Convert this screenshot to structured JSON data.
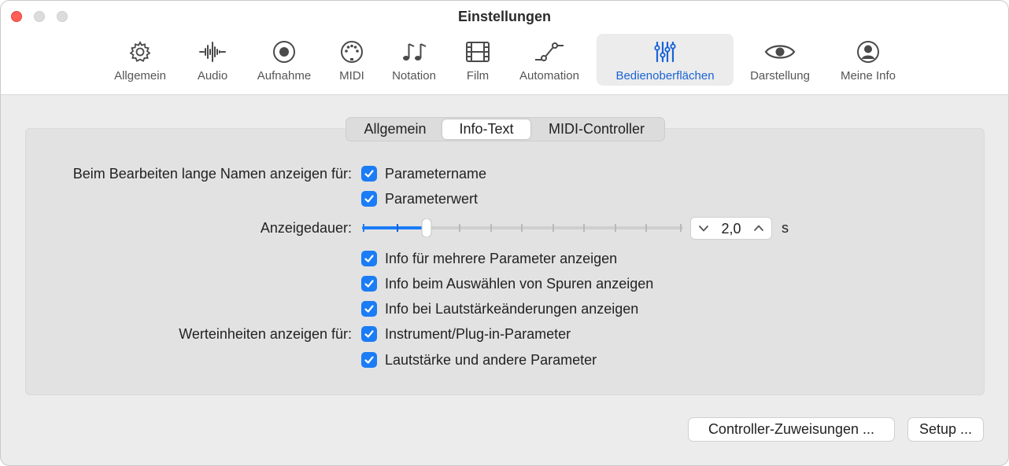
{
  "window": {
    "title": "Einstellungen"
  },
  "toolbar": {
    "items": [
      {
        "label": "Allgemein",
        "icon": "gear-icon"
      },
      {
        "label": "Audio",
        "icon": "waveform-icon"
      },
      {
        "label": "Aufnahme",
        "icon": "record-icon"
      },
      {
        "label": "MIDI",
        "icon": "midi-port-icon"
      },
      {
        "label": "Notation",
        "icon": "music-notes-icon"
      },
      {
        "label": "Film",
        "icon": "film-icon"
      },
      {
        "label": "Automation",
        "icon": "automation-curve-icon"
      },
      {
        "label": "Bedienoberflächen",
        "icon": "sliders-icon",
        "selected": true
      },
      {
        "label": "Darstellung",
        "icon": "eye-icon"
      },
      {
        "label": "Meine Info",
        "icon": "person-circle-icon"
      }
    ],
    "accent": "#1a63d6"
  },
  "tabs": {
    "items": [
      {
        "label": "Allgemein"
      },
      {
        "label": "Info-Text",
        "selected": true
      },
      {
        "label": "MIDI-Controller"
      }
    ]
  },
  "form": {
    "long_names_label": "Beim Bearbeiten lange Namen anzeigen für:",
    "parametername": {
      "label": "Parametername",
      "checked": true
    },
    "parameterwert": {
      "label": "Parameterwert",
      "checked": true
    },
    "duration_label": "Anzeigedauer:",
    "duration_value": "2,0",
    "duration_unit": "s",
    "duration_slider_fraction": 0.2,
    "multi_param": {
      "label": "Info für mehrere Parameter anzeigen",
      "checked": true
    },
    "track_select": {
      "label": "Info beim Auswählen von Spuren anzeigen",
      "checked": true
    },
    "volume_change": {
      "label": "Info bei Lautstärkeänderungen anzeigen",
      "checked": true
    },
    "units_label": "Werteinheiten anzeigen für:",
    "instrument_params": {
      "label": "Instrument/Plug-in-Parameter",
      "checked": true
    },
    "volume_params": {
      "label": "Lautstärke und andere Parameter",
      "checked": true
    },
    "checkbox_color": "#1a7cf6"
  },
  "buttons": {
    "controller_assignments": "Controller-Zuweisungen ...",
    "setup": "Setup ..."
  }
}
